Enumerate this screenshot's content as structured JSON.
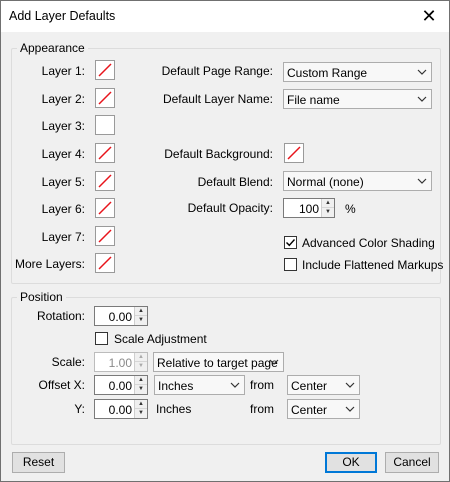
{
  "window": {
    "title": "Add Layer Defaults",
    "close_icon": "close-icon"
  },
  "appearance": {
    "legend": "Appearance",
    "layers": [
      {
        "label": "Layer 1:"
      },
      {
        "label": "Layer 2:"
      },
      {
        "label": "Layer 3:"
      },
      {
        "label": "Layer 4:"
      },
      {
        "label": "Layer 5:"
      },
      {
        "label": "Layer 6:"
      },
      {
        "label": "Layer 7:"
      },
      {
        "label": "More Layers:"
      }
    ],
    "page_range": {
      "label": "Default Page Range:",
      "value": "Custom Range"
    },
    "layer_name": {
      "label": "Default Layer Name:",
      "value": "File name"
    },
    "background": {
      "label": "Default Background:"
    },
    "blend": {
      "label": "Default Blend:",
      "value": "Normal (none)"
    },
    "opacity": {
      "label": "Default Opacity:",
      "value": "100",
      "unit": "%"
    },
    "advanced_color_shading": {
      "label": "Advanced Color Shading",
      "checked": true
    },
    "include_flattened": {
      "label": "Include Flattened Markups",
      "checked": false
    }
  },
  "position": {
    "legend": "Position",
    "rotation": {
      "label": "Rotation:",
      "value": "0.00"
    },
    "scale_adjustment": {
      "label": "Scale Adjustment",
      "checked": false
    },
    "scale": {
      "label": "Scale:",
      "value": "1.00",
      "mode": "Relative to target page"
    },
    "offset_x": {
      "label": "Offset X:",
      "value": "0.00",
      "unit": "Inches",
      "from_label": "from",
      "from_value": "Center"
    },
    "offset_y": {
      "label": "Y:",
      "value": "0.00",
      "unit": "Inches",
      "from_label": "from",
      "from_value": "Center"
    }
  },
  "buttons": {
    "reset": "Reset",
    "ok": "OK",
    "cancel": "Cancel"
  },
  "colors": {
    "accent": "#0078d7",
    "swatch_slash": "#e8141b"
  }
}
